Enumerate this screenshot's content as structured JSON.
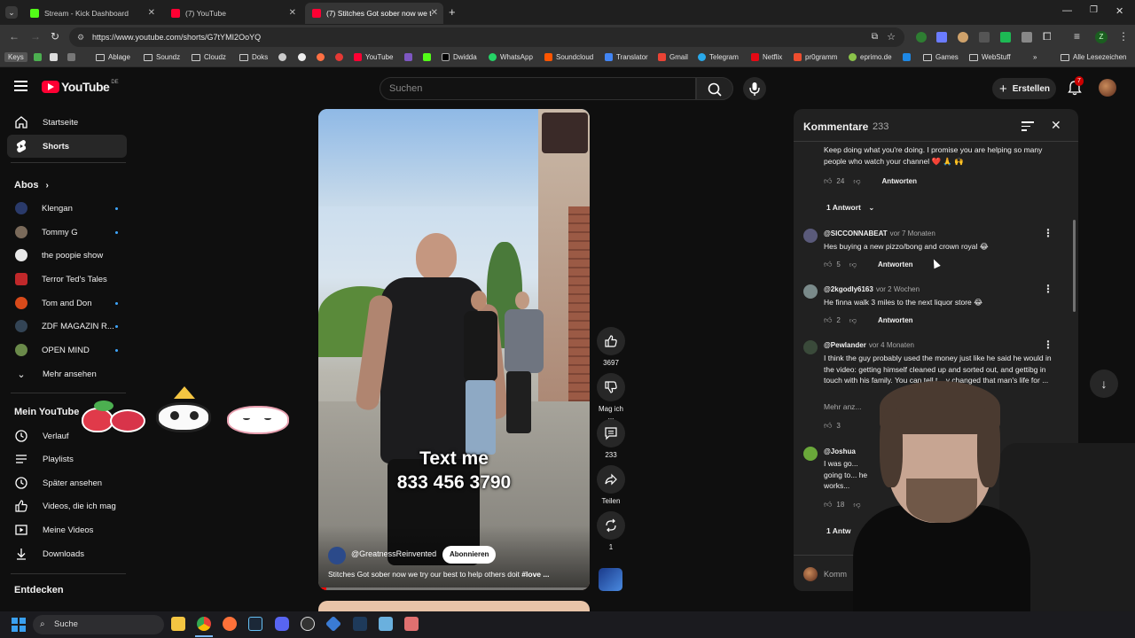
{
  "browser": {
    "tabs": [
      {
        "title": "Stream - Kick Dashboard",
        "color": "#53fc18"
      },
      {
        "title": "(7) YouTube",
        "color": "#ff0033"
      },
      {
        "title": "(7) Stitches Got sober now we t",
        "color": "#ff0033"
      }
    ],
    "url": "https://www.youtube.com/shorts/G7tYMI2OoYQ",
    "bookmarks": [
      "Keys",
      "Ablage",
      "Soundz",
      "Cloudz",
      "Doks",
      "YouTube",
      "Dwidda",
      "WhatsApp",
      "Soundcloud",
      "Translator",
      "Gmail",
      "Telegram",
      "Netflix",
      "pr0gramm",
      "eprimo.de",
      "Games",
      "WebStuff",
      "Alle Lesezeichen"
    ]
  },
  "header": {
    "logo": "YouTube",
    "region": "DE",
    "search_placeholder": "Suchen",
    "create_label": "Erstellen",
    "notif_count": "7"
  },
  "sidebar": {
    "main": [
      {
        "label": "Startseite",
        "icon": "home-icon"
      },
      {
        "label": "Shorts",
        "icon": "shorts-icon"
      }
    ],
    "subs_title": "Abos",
    "subs": [
      {
        "label": "Klengan",
        "color": "#2a3a6a",
        "dot": true
      },
      {
        "label": "Tommy G",
        "color": "#7a6a5a",
        "dot": true
      },
      {
        "label": "the poopie show",
        "color": "#e8e8e8",
        "dot": false
      },
      {
        "label": "Terror Ted's Tales",
        "color": "#c0282a",
        "dot": false
      },
      {
        "label": "Tom and Don",
        "color": "#d84a1a",
        "dot": true
      },
      {
        "label": "ZDF MAGAZIN R...",
        "color": "#334455",
        "dot": true
      },
      {
        "label": "OPEN MIND",
        "color": "#6a8a4a",
        "dot": true
      }
    ],
    "more_label": "Mehr ansehen",
    "you_title": "Mein YouTube",
    "you": [
      {
        "label": "Verlauf",
        "icon": "history-icon"
      },
      {
        "label": "Playlists",
        "icon": "playlist-icon"
      },
      {
        "label": "Später ansehen",
        "icon": "clock-icon"
      },
      {
        "label": "Videos, die ich mag",
        "icon": "thumb-up-icon"
      },
      {
        "label": "Meine Videos",
        "icon": "video-icon"
      },
      {
        "label": "Downloads",
        "icon": "download-icon"
      }
    ],
    "explore_title": "Entdecken"
  },
  "video": {
    "overlay_line1": "Text me",
    "overlay_line2": "833 456 3790",
    "channel": "@GreatnessReinvented",
    "subscribe_label": "Abonnieren",
    "title": "Stitches Got sober now we try our best to help others doit",
    "hashtag": "#love ..."
  },
  "actions": {
    "likes": "3697",
    "dislike_label": "Mag ich ...",
    "comments": "233",
    "share_label": "Teilen",
    "remix": "1"
  },
  "comments": {
    "title": "Kommentare",
    "count": "233",
    "input_placeholder": "Komm",
    "items": [
      {
        "author": "",
        "time": "",
        "text": "Keep doing what you're doing. I promise you are helping so many people who watch your channel ❤️ 🙏 🙌",
        "likes": "24",
        "reply_label": "Antworten",
        "replies_label": "1 Antwort"
      },
      {
        "author": "@SICCONNABEAT",
        "time": "vor 7 Monaten",
        "text": "Hes buying a new pizzo/bong and crown royal 😂",
        "likes": "5",
        "reply_label": "Antworten"
      },
      {
        "author": "@2kgodly6163",
        "time": "vor 2 Wochen",
        "text": "He finna walk 3 miles to the next liquor store 😂",
        "likes": "2",
        "reply_label": "Antworten"
      },
      {
        "author": "@Pewlander",
        "time": "vor 4 Monaten",
        "text": "I think the guy probably used the money just like he said he would in the video: getting himself cleaned up and sorted out, and gettibg in touch with his family. You can tell t... y changed that man's life for ...",
        "more_label": "Mehr anz...",
        "likes": "3"
      },
      {
        "author": "@Joshua",
        "time": "",
        "text": "I was go... going to... he works...",
        "likes": "18",
        "replies_label": "1 Antw"
      }
    ]
  },
  "taskbar": {
    "search_label": "Suche"
  }
}
